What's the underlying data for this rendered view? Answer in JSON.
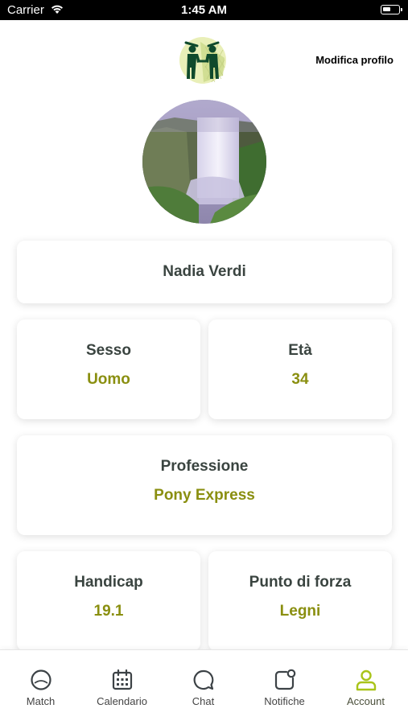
{
  "status_bar": {
    "carrier": "Carrier",
    "time": "1:45 AM"
  },
  "header": {
    "edit_profile_label": "Modifica profilo"
  },
  "profile": {
    "name": "Nadia Verdi",
    "gender": {
      "label": "Sesso",
      "value": "Uomo"
    },
    "age": {
      "label": "Età",
      "value": "34"
    },
    "profession": {
      "label": "Professione",
      "value": "Pony Express"
    },
    "handicap": {
      "label": "Handicap",
      "value": "19.1"
    },
    "strength": {
      "label": "Punto di forza",
      "value": "Legni"
    }
  },
  "tabbar": {
    "items": [
      {
        "label": "Match",
        "icon": "golf-ball-icon"
      },
      {
        "label": "Calendario",
        "icon": "calendar-icon"
      },
      {
        "label": "Chat",
        "icon": "chat-bubble-icon"
      },
      {
        "label": "Notifiche",
        "icon": "notification-icon"
      },
      {
        "label": "Account",
        "icon": "user-icon"
      }
    ],
    "active_index": 4
  },
  "colors": {
    "accent": "#8a8f10",
    "active_tab": "#a9c41a",
    "text": "#3a4440",
    "logo_green": "#0f4a2c"
  }
}
